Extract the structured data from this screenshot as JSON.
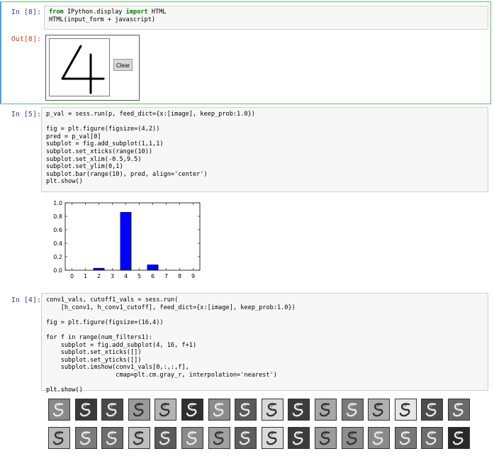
{
  "cells": {
    "c8": {
      "prompt": "In [8]:",
      "line1": {
        "kw": "from",
        "mod": " IPython.display ",
        "kw2": "import",
        "name": " HTML"
      },
      "line2": "HTML(input_form + javascript)",
      "out_prompt": "Out[8]:",
      "clear_label": "Clear",
      "drawn_digit": "4"
    },
    "c5": {
      "prompt": "In [5]:",
      "code": [
        "p_val = sess.run(p, feed_dict={x:[image], keep_prob:1.0})",
        "",
        "fig = plt.figure(figsize=(4,2))",
        "pred = p_val[0]",
        "subplot = fig.add_subplot(1,1,1)",
        "subplot.set_xticks(range(10))",
        "subplot.set_xlim(-0.5,9.5)",
        "subplot.set_ylim(0,1)",
        "subplot.bar(range(10), pred, align='center')",
        "plt.show()"
      ]
    },
    "c4": {
      "prompt": "In [4]:",
      "code": [
        "conv1_vals, cutoff1_vals = sess.run(",
        "    [h_conv1, h_conv1_cutoff], feed_dict={x:[image], keep_prob:1.0})",
        "",
        "fig = plt.figure(figsize=(16,4))",
        "",
        "for f in range(num_filters1):",
        "    subplot = fig.add_subplot(4, 16, f+1)",
        "    subplot.set_xticks([])",
        "    subplot.set_yticks([])",
        "    subplot.imshow(conv1_vals[0,:,:,f],",
        "                   cmap=plt.cm.gray_r, interpolation='nearest')",
        "",
        "plt.show()"
      ]
    }
  },
  "chart_data": {
    "type": "bar",
    "categories": [
      "0",
      "1",
      "2",
      "3",
      "4",
      "5",
      "6",
      "7",
      "8",
      "9"
    ],
    "values": [
      0.0,
      0.0,
      0.03,
      0.0,
      0.86,
      0.0,
      0.08,
      0.0,
      0.0,
      0.0
    ],
    "yticks": [
      "0.0",
      "0.2",
      "0.4",
      "0.6",
      "0.8",
      "1.0"
    ],
    "xlim": [
      -0.5,
      9.5
    ],
    "ylim": [
      0,
      1
    ],
    "bar_color": "#0000ff",
    "title": "",
    "xlabel": "",
    "ylabel": ""
  },
  "filter_images": {
    "count": 32,
    "row1_bg": [
      "#8a8a8a",
      "#3a3a3a",
      "#4a4a4a",
      "#9a9a9a",
      "#b5b5b5",
      "#303030",
      "#8c8c8c",
      "#5a5a5a",
      "#d8d8d8",
      "#3c3c3c",
      "#a8a8a8",
      "#7a7a7a",
      "#b0b0b0",
      "#e6e6e6",
      "#4c4c4c",
      "#6a6a6a"
    ],
    "row2_bg": [
      "#b8b8b8",
      "#7c7c7c",
      "#6e6e6e",
      "#bebebe",
      "#5a5a5a",
      "#8a8a8a",
      "#a0a0a0",
      "#5e5e5e",
      "#dadada",
      "#3c3c3c",
      "#9c9c9c",
      "#8e8e8e",
      "#8a8a8a",
      "#787878",
      "#6c6c6c",
      "#2a2a2a"
    ]
  }
}
